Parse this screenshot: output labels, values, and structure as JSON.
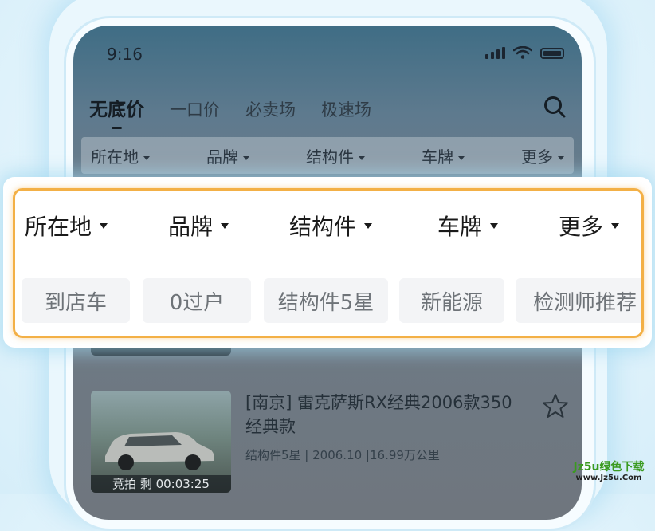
{
  "status": {
    "time": "9:16"
  },
  "tabs": [
    {
      "label": "无底价",
      "active": true
    },
    {
      "label": "一口价",
      "active": false
    },
    {
      "label": "必卖场",
      "active": false
    },
    {
      "label": "极速场",
      "active": false
    }
  ],
  "filters": [
    "所在地",
    "品牌",
    "结构件",
    "车牌",
    "更多"
  ],
  "chips": [
    "到店车",
    "0过户",
    "结构件5星",
    "新能源",
    "检测师推荐"
  ],
  "listing": {
    "title": "[南京] 雷克萨斯RX经典2006款350经典款",
    "meta": "结构件5星 | 2006.10 |16.99万公里",
    "thumb_label": "竞拍 剩 00:03:25"
  },
  "colors": {
    "highlight_border": "#f3b046",
    "watermark_green": "#3a9a1f"
  },
  "watermark": {
    "line1": "Jz5u绿色下载",
    "line2": "www.Jz5u.Com"
  }
}
